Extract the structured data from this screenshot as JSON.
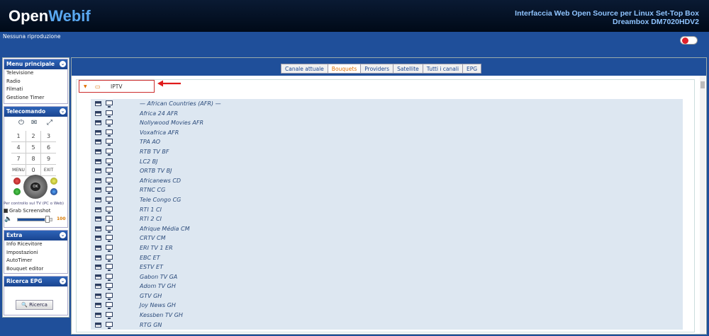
{
  "header": {
    "logo_open": "Open",
    "logo_webif": "Webif",
    "title_line1": "Interfaccia Web Open Source per Linux Set-Top Box",
    "title_line2": "Dreambox DM7020HDV2"
  },
  "status": {
    "text": "Nessuna riproduzione"
  },
  "sidebar": {
    "main_menu": {
      "title": "Menu principale",
      "items": [
        "Televisione",
        "Radio",
        "Filmati",
        "Gestione Timer"
      ]
    },
    "remote": {
      "title": "Telecomando",
      "keys": [
        [
          "1",
          "2",
          "3"
        ],
        [
          "4",
          "5",
          "6"
        ],
        [
          "7",
          "8",
          "9"
        ],
        [
          "MENU",
          "0",
          "EXIT"
        ]
      ],
      "ok_label": "OK",
      "hint": "Per controllo sul TV (PC o Web)",
      "grab_label": "Grab Screenshot",
      "volume_value": "100",
      "volume_fraction": 0.8
    },
    "extras": {
      "title": "Extra",
      "items": [
        "Info Ricevitore",
        "Impostazioni",
        "AutoTimer",
        "Bouquet editor"
      ]
    },
    "epg_search": {
      "title": "Ricerca EPG",
      "button_label": "Ricerca"
    }
  },
  "main": {
    "tabs": [
      "Canale attuale",
      "Bouquets",
      "Providers",
      "Satellite",
      "Tutti i canali",
      "EPG"
    ],
    "active_tab": 1,
    "bouquet": {
      "name": "IPTV"
    },
    "channels": [
      "— African Countries (AFR) —",
      "Africa 24 AFR",
      "Nollywood Movies AFR",
      "Voxafrica AFR",
      "TPA AO",
      "RTB TV BF",
      "LC2 BJ",
      "ORTB TV BJ",
      "Africanews CD",
      "RTNC CG",
      "Tele Congo CG",
      "RTI 1 CI",
      "RTI 2 CI",
      "Afrique Média CM",
      "CRTV CM",
      "ERI TV 1 ER",
      "EBC ET",
      "ESTV ET",
      "Gabon TV GA",
      "Adom TV GH",
      "GTV GH",
      "Joy News GH",
      "Kessben TV GH",
      "RTG GN"
    ]
  },
  "colors": {
    "accent": "#1f4f9a",
    "active_tab": "#e07000",
    "annotation": "#cc2c2c"
  }
}
